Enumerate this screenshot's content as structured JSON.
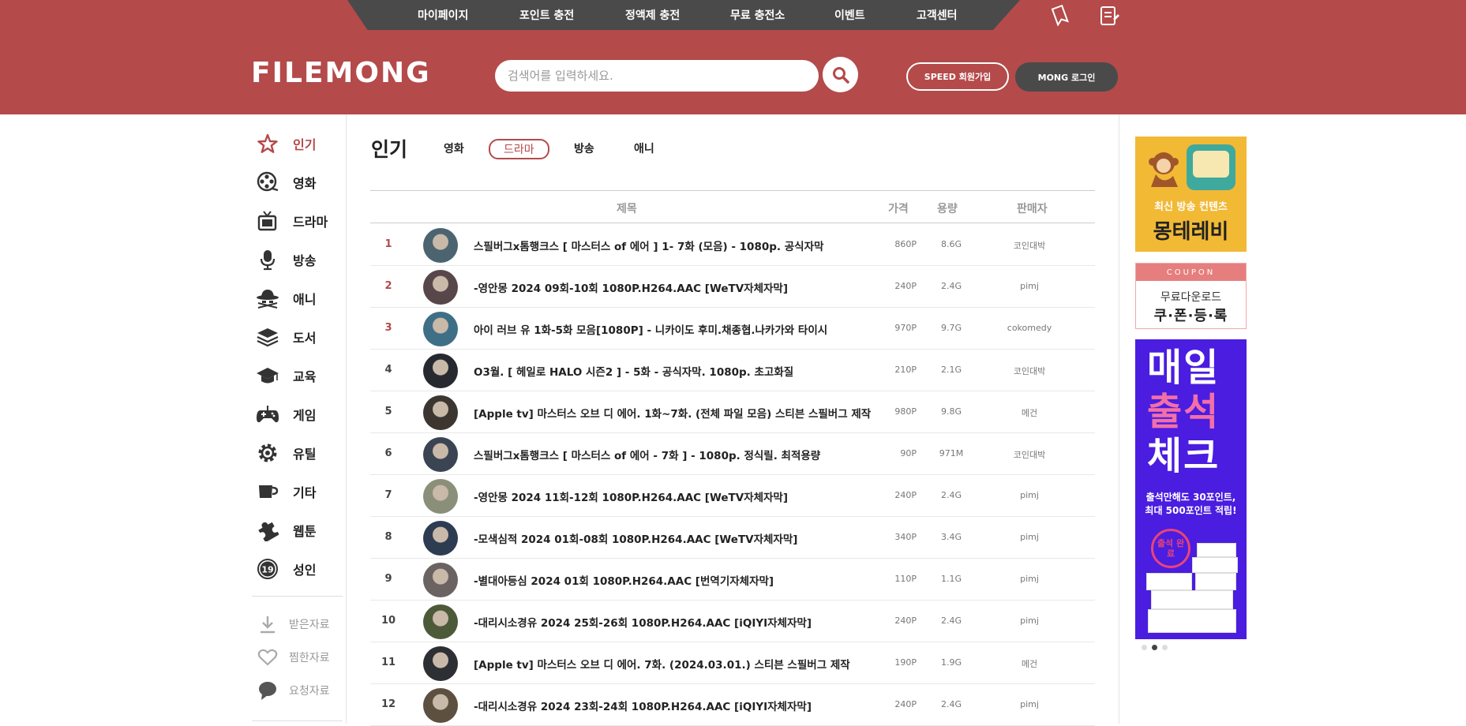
{
  "topnav": [
    "마이페이지",
    "포인트 충전",
    "정액제 충전",
    "무료 충전소",
    "이벤트",
    "고객센터"
  ],
  "logo": "FILEMONG",
  "search": {
    "placeholder": "검색어를 입력하세요."
  },
  "auth": {
    "join": "SPEED 회원가입",
    "login": "MONG 로그인"
  },
  "sidebar": {
    "categories": [
      {
        "label": "인기",
        "icon": "star-icon",
        "active": true
      },
      {
        "label": "영화",
        "icon": "film-reel-icon"
      },
      {
        "label": "드라마",
        "icon": "tv-icon"
      },
      {
        "label": "방송",
        "icon": "microphone-icon"
      },
      {
        "label": "애니",
        "icon": "hat-icon"
      },
      {
        "label": "도서",
        "icon": "books-icon"
      },
      {
        "label": "교육",
        "icon": "graduation-cap-icon"
      },
      {
        "label": "게임",
        "icon": "gamepad-icon"
      },
      {
        "label": "유틸",
        "icon": "gear-icon"
      },
      {
        "label": "기타",
        "icon": "cup-icon"
      },
      {
        "label": "웹툰",
        "icon": "puzzle-icon"
      },
      {
        "label": "성인",
        "icon": "adult-19-icon"
      }
    ],
    "sub": [
      {
        "label": "받은자료",
        "icon": "download-icon"
      },
      {
        "label": "찜한자료",
        "icon": "heart-icon"
      },
      {
        "label": "요청자료",
        "icon": "chat-bubble-icon"
      }
    ]
  },
  "main": {
    "title": "인기",
    "tabs": [
      {
        "label": "영화",
        "active": false
      },
      {
        "label": "드라마",
        "active": true
      },
      {
        "label": "방송",
        "active": false
      },
      {
        "label": "애니",
        "active": false
      }
    ],
    "columns": {
      "title": "제목",
      "price": "가격",
      "size": "용량",
      "seller": "판매자"
    },
    "rows": [
      {
        "rank": "1",
        "title": "스필버그x톰행크스 [ 마스터스 of 에어 ] 1- 7화 (모음) - 1080p. 공식자막",
        "price": "860P",
        "size": "8.6G",
        "seller": "코인대박",
        "thumb": "#4b6470"
      },
      {
        "rank": "2",
        "title": "-영안몽 2024 09회-10회 1080P.H264.AAC [WeTV자체자막]",
        "price": "240P",
        "size": "2.4G",
        "seller": "pimj",
        "thumb": "#57464a"
      },
      {
        "rank": "3",
        "title": "아이 러브 유 1화-5화 모음[1080P] - 니카이도 후미.채종협.나카가와 타이시",
        "price": "970P",
        "size": "9.7G",
        "seller": "cokomedy",
        "thumb": "#3f6f86"
      },
      {
        "rank": "4",
        "title": "O3월. [ 헤일로 HALO 시즌2 ] - 5화 - 공식자막. 1080p. 초고화질",
        "price": "210P",
        "size": "2.1G",
        "seller": "코인대박",
        "thumb": "#262a30"
      },
      {
        "rank": "5",
        "title": "[Apple tv] 마스터스 오브 디 에어. 1화~7화. (전체 파일 모음) 스티븐 스필버그 제작",
        "price": "980P",
        "size": "9.8G",
        "seller": "메건",
        "thumb": "#3c3530"
      },
      {
        "rank": "6",
        "title": "스필버그x톰행크스 [ 마스터스 of 에어 - 7화 ] - 1080p. 정식릴. 최적용량",
        "price": "90P",
        "size": "971M",
        "seller": "코인대박",
        "thumb": "#3b4452"
      },
      {
        "rank": "7",
        "title": "-영안몽 2024 11회-12회 1080P.H264.AAC [WeTV자체자막]",
        "price": "240P",
        "size": "2.4G",
        "seller": "pimj",
        "thumb": "#8a8f7a"
      },
      {
        "rank": "8",
        "title": "-모색심적 2024 01회-08회 1080P.H264.AAC [WeTV자체자막]",
        "price": "340P",
        "size": "3.4G",
        "seller": "pimj",
        "thumb": "#2e3c52"
      },
      {
        "rank": "9",
        "title": "-별대아등심 2024 01회 1080P.H264.AAC [번역기자체자막]",
        "price": "110P",
        "size": "1.1G",
        "seller": "pimj",
        "thumb": "#6b6262"
      },
      {
        "rank": "10",
        "title": "-대리시소경유 2024 25회-26회 1080P.H264.AAC [iQIYI자체자막]",
        "price": "240P",
        "size": "2.4G",
        "seller": "pimj",
        "thumb": "#4d5a3a"
      },
      {
        "rank": "11",
        "title": "[Apple tv] 마스터스 오브 디 에어. 7화. (2024.03.01.) 스티븐 스필버그 제작",
        "price": "190P",
        "size": "1.9G",
        "seller": "메건",
        "thumb": "#2c2f33"
      },
      {
        "rank": "12",
        "title": "-대리시소경유 2024 23회-24회 1080P.H264.AAC [iQIYI자체자막]",
        "price": "240P",
        "size": "2.4G",
        "seller": "pimj",
        "thumb": "#5e5040"
      }
    ]
  },
  "banners": {
    "b1": {
      "line1": "최신 방송 컨텐츠",
      "line2": "몽테레비"
    },
    "b2": {
      "tag": "COUPON",
      "line1": "무료다운로드",
      "line2": "쿠·폰·등·록"
    },
    "b3": {
      "l1": "매일",
      "l2": "출석",
      "l3": "체크",
      "s1": "출석만해도 30포인트,",
      "s2": "최대 500포인트 적립!",
      "stamp": "출석 완료"
    }
  },
  "colors": {
    "brand": "#b44a4a",
    "dark": "#4a4a4a"
  }
}
